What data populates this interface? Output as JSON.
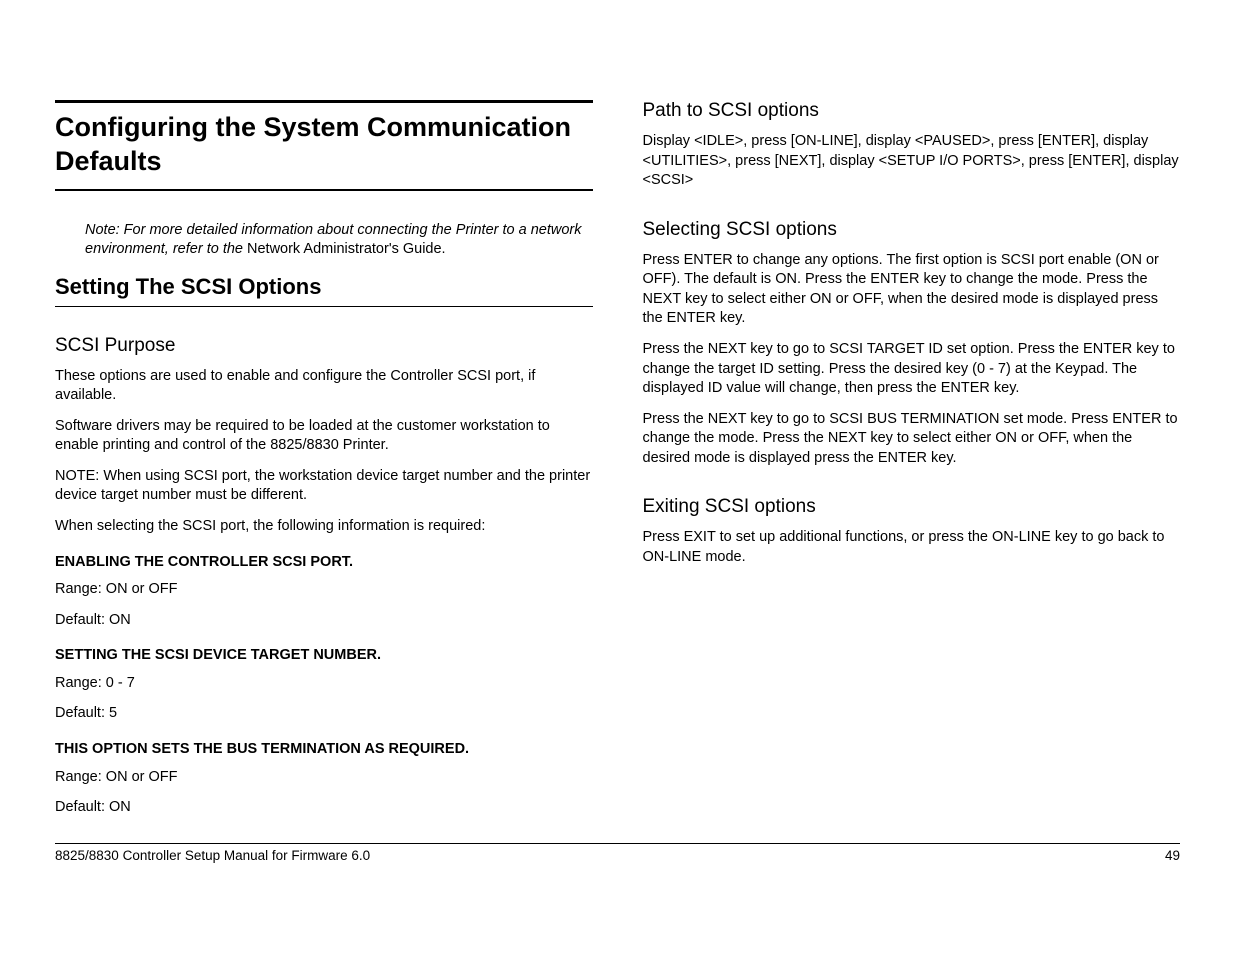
{
  "left": {
    "title": "Configuring the System Communication Defaults",
    "note_italic": "Note:  For more detailed information about connecting the Printer to a network environment, refer to the ",
    "note_roman": "Network Administrator's Guide.",
    "h2": "Setting The SCSI Options",
    "purpose_h": "SCSI Purpose",
    "purpose_p1": "These options are used to enable and configure the Controller SCSI port, if available.",
    "purpose_p2": "Software drivers may be required to be loaded at the customer workstation to enable printing and control of the 8825/8830 Printer.",
    "purpose_p3": "NOTE: When using SCSI port, the workstation device target number and the printer device target number must be different.",
    "purpose_p4": "When selecting the SCSI port, the following information is required:",
    "s1_h": "ENABLING THE CONTROLLER SCSI PORT.",
    "s1_r": "Range: ON or OFF",
    "s1_d": "Default: ON",
    "s2_h": "SETTING THE SCSI DEVICE TARGET NUMBER.",
    "s2_r": "Range: 0 - 7",
    "s2_d": "Default: 5",
    "s3_h": "THIS OPTION SETS THE BUS TERMINATION AS REQUIRED.",
    "s3_r": "Range: ON or OFF",
    "s3_d": "Default: ON"
  },
  "right": {
    "path_h": "Path to SCSI options",
    "path_p": "Display <IDLE>, press [ON-LINE], display <PAUSED>, press [ENTER], display <UTILITIES>, press [NEXT], display <SETUP I/O PORTS>, press [ENTER], display <SCSI>",
    "sel_h": "Selecting SCSI options",
    "sel_p1": "Press ENTER to change any options.  The first option is SCSI port enable (ON or OFF).  The default is ON. Press the ENTER key to change the mode. Press the NEXT key to select either ON or OFF, when the desired mode is displayed press the ENTER key.",
    "sel_p2": "Press the NEXT key to go to SCSI TARGET ID set option. Press the ENTER key to change the target ID setting. Press the desired key (0 - 7) at the Keypad. The displayed ID value will change, then press the ENTER key.",
    "sel_p3": "Press the NEXT key to go to SCSI BUS TERMINATION set mode. Press ENTER to change the mode. Press the NEXT key to select either ON or OFF, when the desired mode is displayed press the ENTER key.",
    "exit_h": "Exiting SCSI options",
    "exit_p": "Press EXIT to set up additional functions, or press the ON-LINE key to go back to ON-LINE mode."
  },
  "footer": {
    "left": "8825/8830 Controller Setup Manual for Firmware 6.0",
    "right": "49"
  }
}
